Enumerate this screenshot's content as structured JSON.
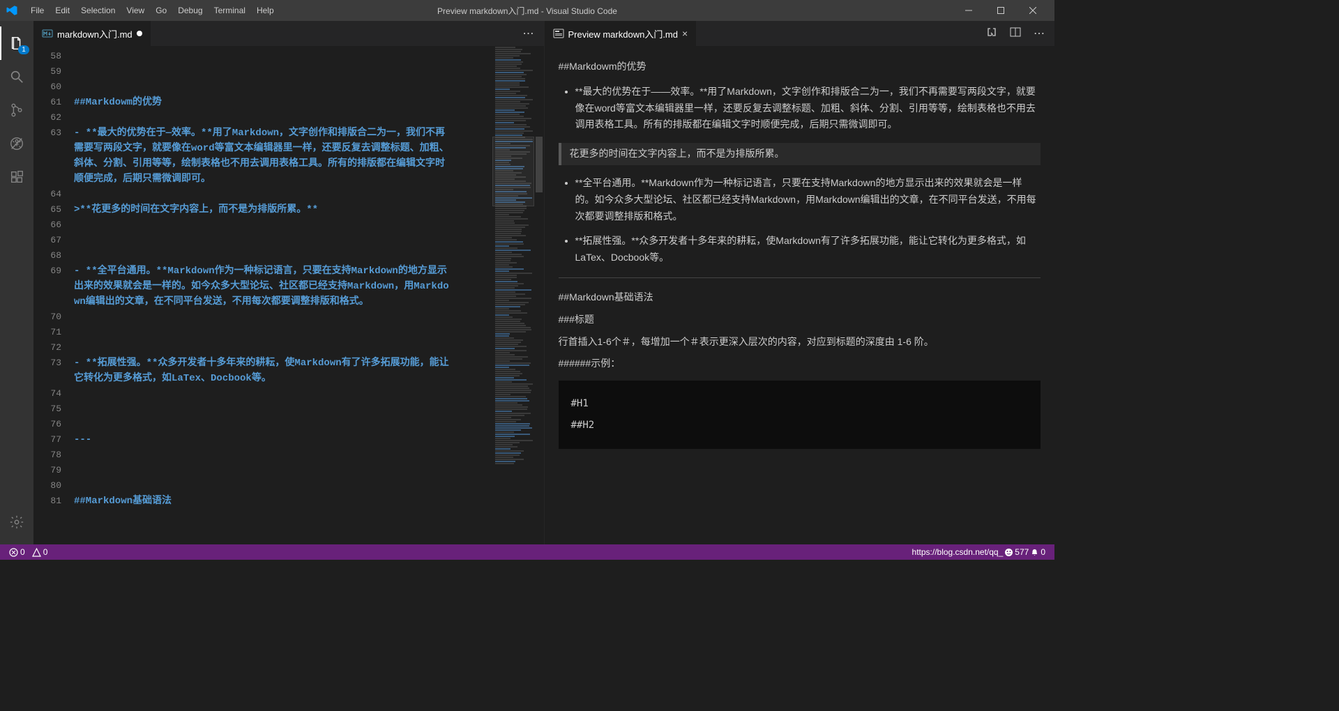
{
  "window": {
    "title": "Preview markdown入门.md - Visual Studio Code"
  },
  "menu": [
    "File",
    "Edit",
    "Selection",
    "View",
    "Go",
    "Debug",
    "Terminal",
    "Help"
  ],
  "activity": {
    "explorer_badge": "1"
  },
  "editor": {
    "tab_label": "markdown入门.md",
    "lines": {
      "start": 58,
      "content": [
        "",
        "",
        "",
        "##Markdowm的优势",
        "",
        "- **最大的优势在于—效率。**用了Markdown，文字创作和排版合二为一，我们不再需要写两段文字，就要像在word等富文本编辑器里一样，还要反复去调整标题、加粗、斜体、分割、引用等等，绘制表格也不用去调用表格工具。所有的排版都在编辑文字时顺便完成，后期只需微调即可。",
        "",
        ">**花更多的时间在文字内容上，而不是为排版所累。**",
        "",
        "",
        "",
        "- **全平台通用。**Markdown作为一种标记语言，只要在支持Markdown的地方显示出来的效果就会是一样的。如今众多大型论坛、社区都已经支持Markdown，用Markdown编辑出的文章，在不同平台发送，不用每次都要调整排版和格式。",
        "",
        "",
        "",
        "- **拓展性强。**众多开发者十多年来的耕耘，使Markdown有了许多拓展功能，能让它转化为更多格式，如LaTex、Docbook等。",
        "",
        "",
        "",
        "---",
        "",
        "",
        "",
        "##Markdown基础语法"
      ]
    }
  },
  "preview": {
    "tab_label": "Preview markdown入门.md",
    "h2a": "##Markdowm的优势",
    "li1_bold": "**最大的优势在于——效率。**",
    "li1_rest": "用了Markdown，文字创作和排版合二为一，我们不再需要写两段文字，就要像在word等富文本编辑器里一样，还要反复去调整标题、加粗、斜体、分割、引用等等，绘制表格也不用去调用表格工具。所有的排版都在编辑文字时顺便完成，后期只需微调即可。",
    "blockquote": "花更多的时间在文字内容上，而不是为排版所累。",
    "li2_bold": "**全平台通用。**",
    "li2_rest": "Markdown作为一种标记语言，只要在支持Markdown的地方显示出来的效果就会是一样的。如今众多大型论坛、社区都已经支持Markdown，用Markdown编辑出的文章，在不同平台发送，不用每次都要调整排版和格式。",
    "li3_bold": "**拓展性强。**",
    "li3_rest": "众多开发者十多年来的耕耘，使Markdown有了许多拓展功能，能让它转化为更多格式，如LaTex、Docbook等。",
    "h2b": "##Markdown基础语法",
    "h3": "###标题",
    "p_desc": "行首插入1-6个＃，每增加一个＃表示更深入层次的内容，对应到标题的深度由 1-6 阶。",
    "h6": "######示例：",
    "code1": "#H1",
    "code2": "##H2"
  },
  "status": {
    "errors": "0",
    "warnings": "0",
    "right_url": "https://blog.csdn.net/qq_",
    "right_suffix": "577",
    "right_suffix2": "0"
  }
}
